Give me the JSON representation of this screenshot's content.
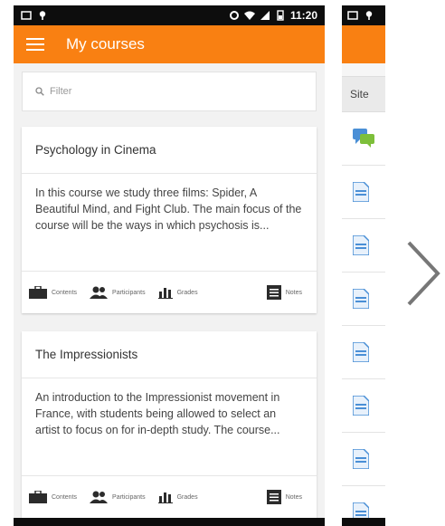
{
  "status_bar": {
    "time": "11:20"
  },
  "app_bar": {
    "title": "My courses"
  },
  "filter": {
    "placeholder": "Filter"
  },
  "courses": [
    {
      "title": "Psychology in Cinema",
      "summary": "In this course we study three films: Spider, A Beautiful Mind, and Fight Club. The main focus of the course will be the ways in which psychosis is...",
      "actions": {
        "contents": "Contents",
        "participants": "Participants",
        "grades": "Grades",
        "notes": "Notes"
      }
    },
    {
      "title": "The Impressionists",
      "summary": "An introduction to the Impressionist movement in France, with students being allowed to select an artist to focus on for in-depth study. The course...",
      "actions": {
        "contents": "Contents",
        "participants": "Participants",
        "grades": "Grades",
        "notes": "Notes"
      }
    }
  ],
  "second_screen": {
    "header": "Site",
    "row_icons": [
      "forum-icon",
      "file-icon",
      "file-icon",
      "file-icon",
      "file-icon",
      "file-icon",
      "file-icon",
      "file-icon"
    ]
  },
  "colors": {
    "accent": "#f98012",
    "status_bar": "#0d0d0d",
    "background": "#f2f2f2"
  },
  "icons": {
    "next": "chevron-right-icon"
  }
}
